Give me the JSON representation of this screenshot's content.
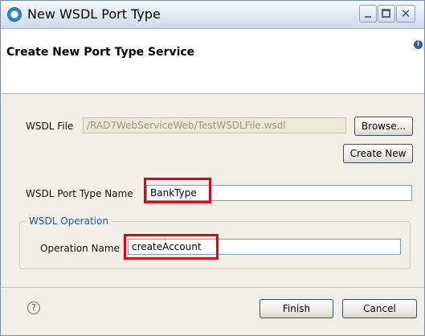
{
  "window": {
    "title": "New WSDL Port Type",
    "controls": {
      "minimize_icon": "minimize-icon",
      "maximize_icon": "maximize-icon",
      "close_icon": "close-icon"
    }
  },
  "header": {
    "title": "Create New Port Type Service",
    "icon": "info-icon"
  },
  "form": {
    "wsdl_file": {
      "label": "WSDL File",
      "value": "/RAD7WebServiceWeb/TestWSDLFile.wsdl",
      "browse_label": "Browse...",
      "create_new_label": "Create New"
    },
    "port_type_name": {
      "label": "WSDL Port Type Name",
      "value": "BankType"
    },
    "operation_group": {
      "legend": "WSDL Operation",
      "operation_name_label": "Operation Name",
      "operation_name_value": "createAccount"
    }
  },
  "footer": {
    "help_glyph": "?",
    "finish_label": "Finish",
    "cancel_label": "Cancel"
  },
  "colors": {
    "highlight": "#e4001b",
    "group_legend": "#2655a8",
    "dialog_bg": "#f1efe6"
  }
}
